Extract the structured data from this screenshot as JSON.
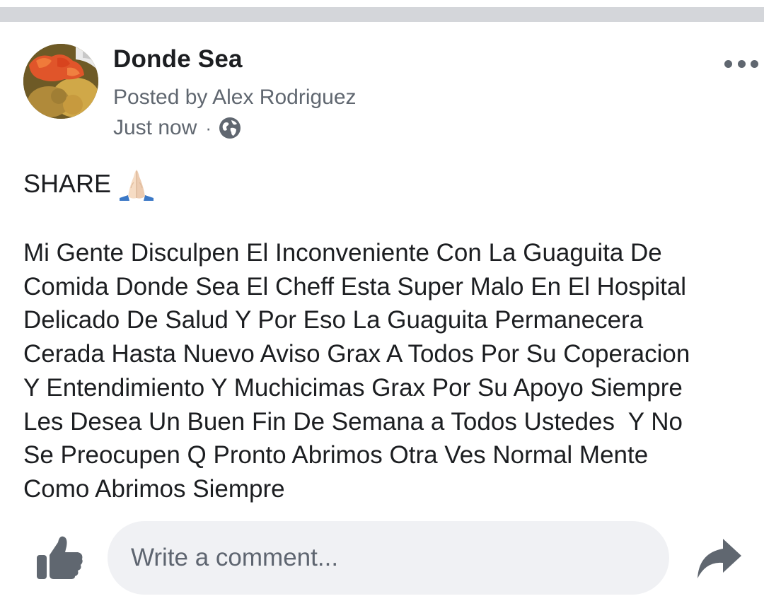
{
  "post": {
    "page_name": "Donde Sea",
    "posted_by": "Posted by Alex Rodriguez",
    "timestamp": "Just now",
    "separator": "·",
    "privacy_icon": "globe-icon",
    "share_heading": "SHARE",
    "share_emoji": "folded-hands-emoji",
    "body_lines": [
      "Mi Gente Disculpen El Inconveniente Con La Guaguita De",
      "Comida Donde Sea El Cheff Esta Super Malo En El Hospital",
      "Delicado De Salud Y Por Eso La Guaguita Permanecera",
      "Cerada Hasta Nuevo Aviso Grax A Todos Por Su Coperacion",
      "Y Entendimiento Y Muchicimas Grax Por Su Apoyo Siempre",
      "Les Desea Un Buen Fin De Semana a Todos Ustedes  Y No",
      "Se Preocupen Q Pronto Abrimos Otra Ves Normal Mente",
      "Como Abrimos Siempre"
    ]
  },
  "actions": {
    "like_icon": "thumbs-up-icon",
    "comment_placeholder": "Write a comment...",
    "share_icon": "share-arrow-icon",
    "more_icon": "more-options-icon"
  },
  "colors": {
    "top_bar": "#d4d6da",
    "secondary_text": "#606770",
    "icon_gray": "#606770",
    "comment_box": "#f0f1f4"
  }
}
